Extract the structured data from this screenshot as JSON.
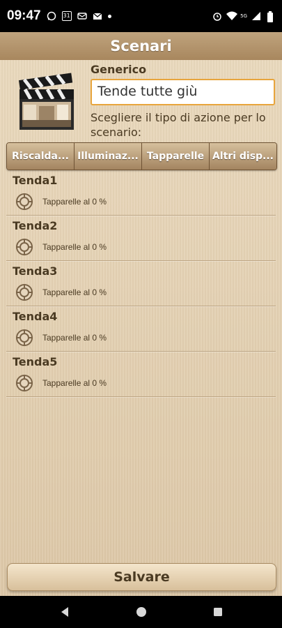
{
  "status_bar": {
    "time": "09:47",
    "notification_icons": [
      "whatsapp-icon",
      "calendar-icon",
      "message-icon",
      "mail-icon"
    ],
    "calendar_day": "31",
    "signal_label": "5G"
  },
  "header": {
    "title": "Scenari"
  },
  "scenario": {
    "category": "Generico",
    "name_field_value": "Tende tutte giù",
    "instruction": "Scegliere il tipo di azione per lo scenario:"
  },
  "tabs": [
    {
      "label": "Riscalda..."
    },
    {
      "label": "Illuminaz..."
    },
    {
      "label": "Tapparelle"
    },
    {
      "label": "Altri disp..."
    }
  ],
  "devices": [
    {
      "name": "Tenda1",
      "status": "Tapparelle al 0 %"
    },
    {
      "name": "Tenda2",
      "status": "Tapparelle al 0 %"
    },
    {
      "name": "Tenda3",
      "status": "Tapparelle al 0 %"
    },
    {
      "name": "Tenda4",
      "status": "Tapparelle al 0 %"
    },
    {
      "name": "Tenda5",
      "status": "Tapparelle al 0 %"
    }
  ],
  "save_button": {
    "label": "Salvare"
  },
  "colors": {
    "header": "#a8875e",
    "accent_border": "#e8a53c",
    "background": "#e6d4b7",
    "text": "#4a3a22"
  }
}
